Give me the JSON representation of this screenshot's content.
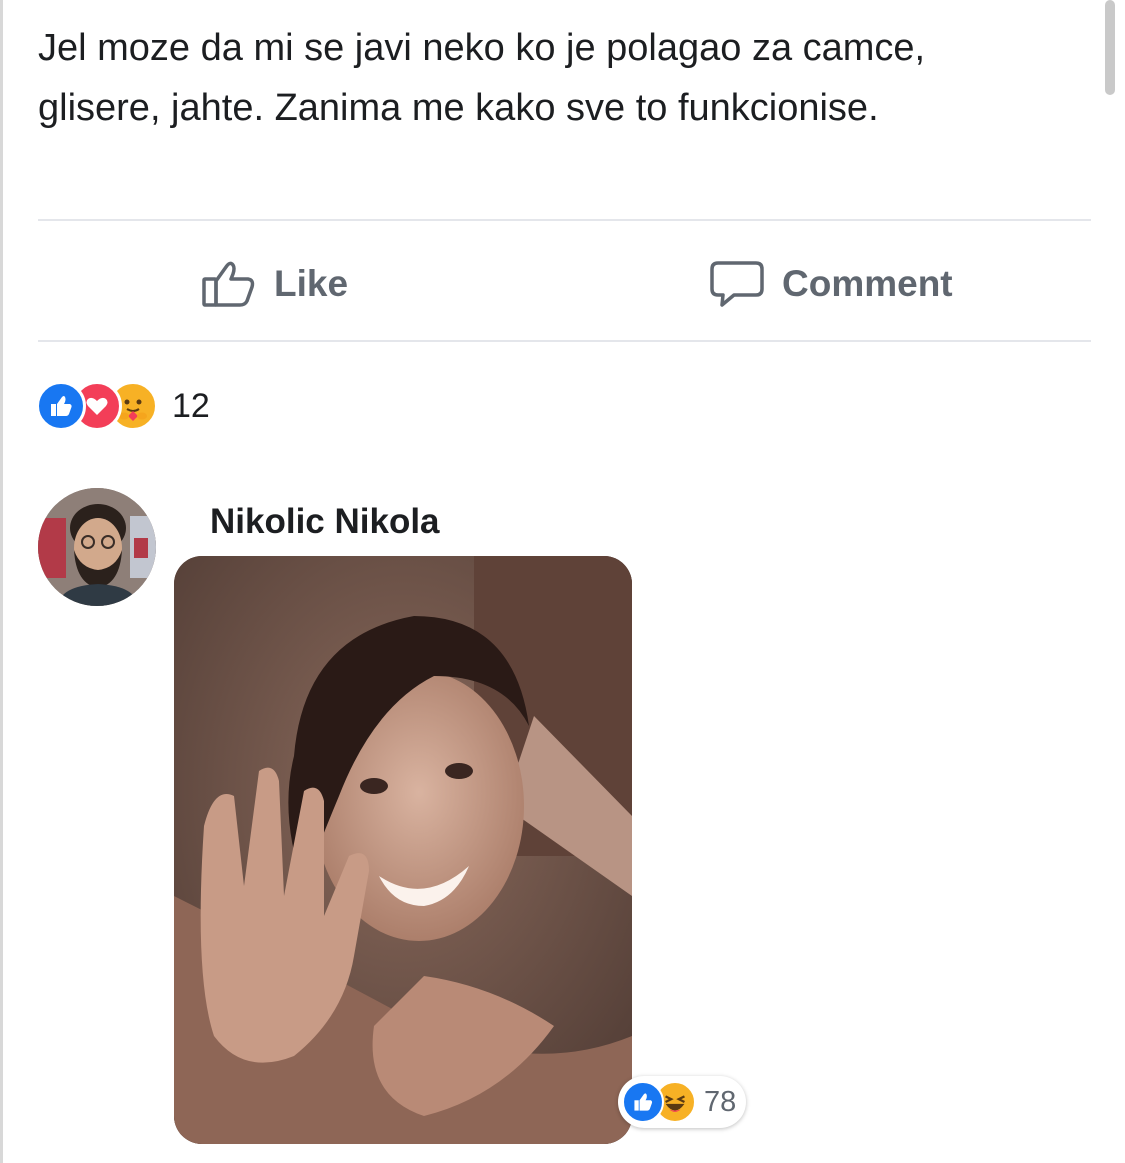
{
  "post": {
    "text": "Jel moze da mi se javi neko ko je polagao za camce, glisere, jahte. Zanima me kako sve to funkcionise."
  },
  "actions": {
    "like_label": "Like",
    "comment_label": "Comment"
  },
  "reactions": {
    "icons": [
      "like-icon",
      "love-icon",
      "care-icon"
    ],
    "count": "12"
  },
  "comment": {
    "author": "Nikolic Nikola",
    "reactions": {
      "icons": [
        "like-icon",
        "haha-icon"
      ],
      "count": "78"
    }
  },
  "colors": {
    "facebook_blue": "#1877f2",
    "love_red": "#f33e58",
    "emoji_yellow": "#f7b125",
    "action_gray": "#606770"
  }
}
